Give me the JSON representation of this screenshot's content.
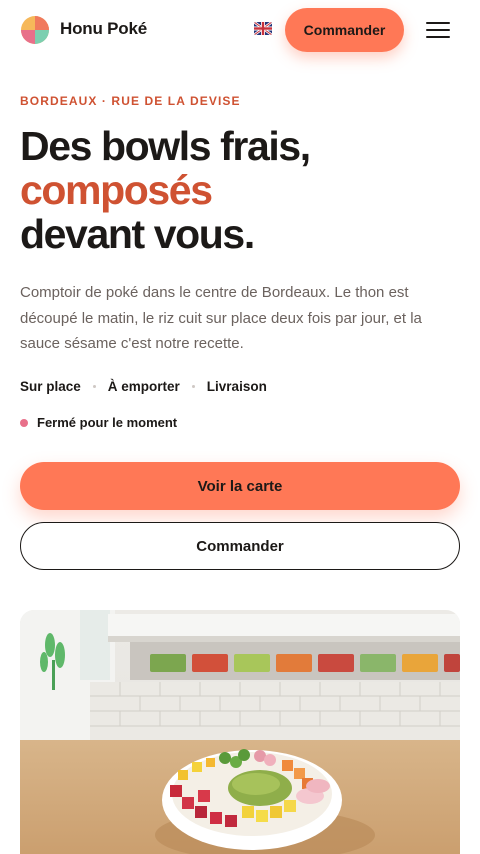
{
  "header": {
    "brand": "Honu Poké",
    "language_icon": "uk-flag-icon",
    "order_label": "Commander",
    "menu_icon": "hamburger-menu-icon"
  },
  "hero": {
    "eyebrow": "BORDEAUX · RUE DE LA DEVISE",
    "headline_line1": "Des bowls frais,",
    "headline_accent": "composés",
    "headline_line3": "devant vous.",
    "description": "Comptoir de poké dans le centre de Bordeaux. Le thon est découpé le matin, le riz cuit sur place deux fois par jour, et la sauce sésame c'est notre recette.",
    "modes": [
      "Sur place",
      "À emporter",
      "Livraison"
    ],
    "status": "Fermé pour le moment",
    "primary_cta": "Voir la carte",
    "secondary_cta": "Commander"
  },
  "colors": {
    "accent": "#ff7856",
    "accent_text": "#cf5232",
    "status_closed": "#e8708a",
    "text": "#1c1917",
    "muted": "#6b625e"
  }
}
